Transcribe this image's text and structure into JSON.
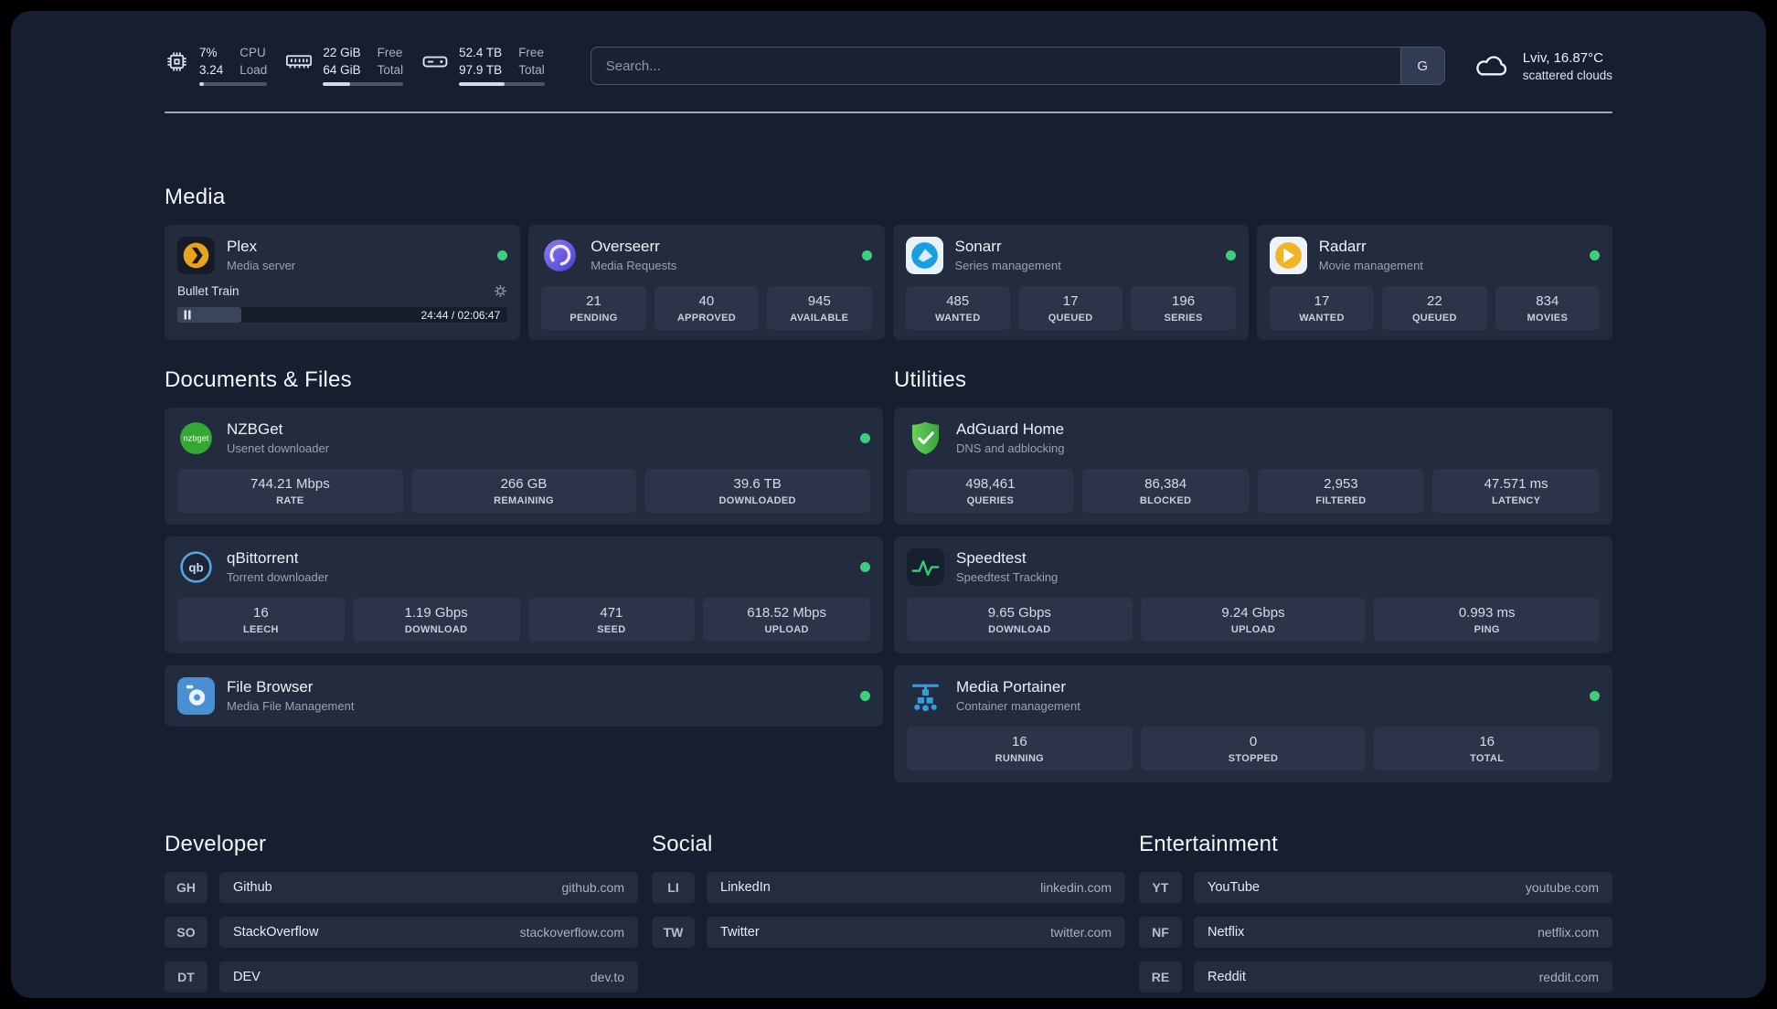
{
  "topbar": {
    "cpu": {
      "percent": "7%",
      "load": "3.24",
      "label_top": "CPU",
      "label_bottom": "Load",
      "progress": 7
    },
    "memory": {
      "free": "22 GiB",
      "total": "64 GiB",
      "label_top": "Free",
      "label_bottom": "Total",
      "progress": 34
    },
    "disk": {
      "free": "52.4 TB",
      "total": "97.9 TB",
      "label_top": "Free",
      "label_bottom": "Total",
      "progress": 53
    },
    "search": {
      "placeholder": "Search...",
      "engine_button": "G"
    },
    "weather": {
      "location": "Lviv, 16.87°C",
      "condition": "scattered clouds"
    }
  },
  "sections": {
    "media": {
      "title": "Media"
    },
    "documents": {
      "title": "Documents & Files"
    },
    "utilities": {
      "title": "Utilities"
    }
  },
  "media_apps": [
    {
      "name": "Plex",
      "subtitle": "Media server",
      "online": true,
      "player": {
        "title": "Bullet Train",
        "time": "24:44 / 02:06:47",
        "progress": 19.5
      }
    },
    {
      "name": "Overseerr",
      "subtitle": "Media Requests",
      "online": true,
      "stats": [
        {
          "value": "21",
          "label": "PENDING"
        },
        {
          "value": "40",
          "label": "APPROVED"
        },
        {
          "value": "945",
          "label": "AVAILABLE"
        }
      ]
    },
    {
      "name": "Sonarr",
      "subtitle": "Series management",
      "online": true,
      "stats": [
        {
          "value": "485",
          "label": "WANTED"
        },
        {
          "value": "17",
          "label": "QUEUED"
        },
        {
          "value": "196",
          "label": "SERIES"
        }
      ]
    },
    {
      "name": "Radarr",
      "subtitle": "Movie management",
      "online": true,
      "stats": [
        {
          "value": "17",
          "label": "WANTED"
        },
        {
          "value": "22",
          "label": "QUEUED"
        },
        {
          "value": "834",
          "label": "MOVIES"
        }
      ]
    }
  ],
  "documents_apps": [
    {
      "name": "NZBGet",
      "subtitle": "Usenet downloader",
      "online": true,
      "stats": [
        {
          "value": "744.21 Mbps",
          "label": "RATE"
        },
        {
          "value": "266 GB",
          "label": "REMAINING"
        },
        {
          "value": "39.6 TB",
          "label": "DOWNLOADED"
        }
      ]
    },
    {
      "name": "qBittorrent",
      "subtitle": "Torrent downloader",
      "online": true,
      "stats": [
        {
          "value": "16",
          "label": "LEECH"
        },
        {
          "value": "1.19 Gbps",
          "label": "DOWNLOAD"
        },
        {
          "value": "471",
          "label": "SEED"
        },
        {
          "value": "618.52 Mbps",
          "label": "UPLOAD"
        }
      ]
    },
    {
      "name": "File Browser",
      "subtitle": "Media File Management",
      "online": true
    }
  ],
  "utilities_apps": [
    {
      "name": "AdGuard Home",
      "subtitle": "DNS and adblocking",
      "online": false,
      "stats": [
        {
          "value": "498,461",
          "label": "QUERIES"
        },
        {
          "value": "86,384",
          "label": "BLOCKED"
        },
        {
          "value": "2,953",
          "label": "FILTERED"
        },
        {
          "value": "47.571 ms",
          "label": "LATENCY"
        }
      ]
    },
    {
      "name": "Speedtest",
      "subtitle": "Speedtest Tracking",
      "online": false,
      "stats": [
        {
          "value": "9.65 Gbps",
          "label": "DOWNLOAD"
        },
        {
          "value": "9.24 Gbps",
          "label": "UPLOAD"
        },
        {
          "value": "0.993 ms",
          "label": "PING"
        }
      ]
    },
    {
      "name": "Media Portainer",
      "subtitle": "Container management",
      "online": true,
      "stats": [
        {
          "value": "16",
          "label": "RUNNING"
        },
        {
          "value": "0",
          "label": "STOPPED"
        },
        {
          "value": "16",
          "label": "TOTAL"
        }
      ]
    }
  ],
  "link_groups": [
    {
      "title": "Developer",
      "links": [
        {
          "abbr": "GH",
          "name": "Github",
          "url": "github.com"
        },
        {
          "abbr": "SO",
          "name": "StackOverflow",
          "url": "stackoverflow.com"
        },
        {
          "abbr": "DT",
          "name": "DEV",
          "url": "dev.to"
        }
      ]
    },
    {
      "title": "Social",
      "links": [
        {
          "abbr": "LI",
          "name": "LinkedIn",
          "url": "linkedin.com"
        },
        {
          "abbr": "TW",
          "name": "Twitter",
          "url": "twitter.com"
        }
      ]
    },
    {
      "title": "Entertainment",
      "links": [
        {
          "abbr": "YT",
          "name": "YouTube",
          "url": "youtube.com"
        },
        {
          "abbr": "NF",
          "name": "Netflix",
          "url": "netflix.com"
        },
        {
          "abbr": "RE",
          "name": "Reddit",
          "url": "reddit.com"
        }
      ]
    }
  ],
  "colors": {
    "page_background": "#171e2f",
    "card_background": "#232b3e",
    "stat_background": "#2b3448",
    "status_online": "#3ecf7e",
    "plex_amber": "#e8a51c",
    "sonarr_blue": "#1b9de2",
    "radarr_gold": "#f0b429",
    "adguard_green": "#4cbb4a",
    "speedtest_green": "#2fca74",
    "portainer_blue": "#2f9fe0"
  }
}
